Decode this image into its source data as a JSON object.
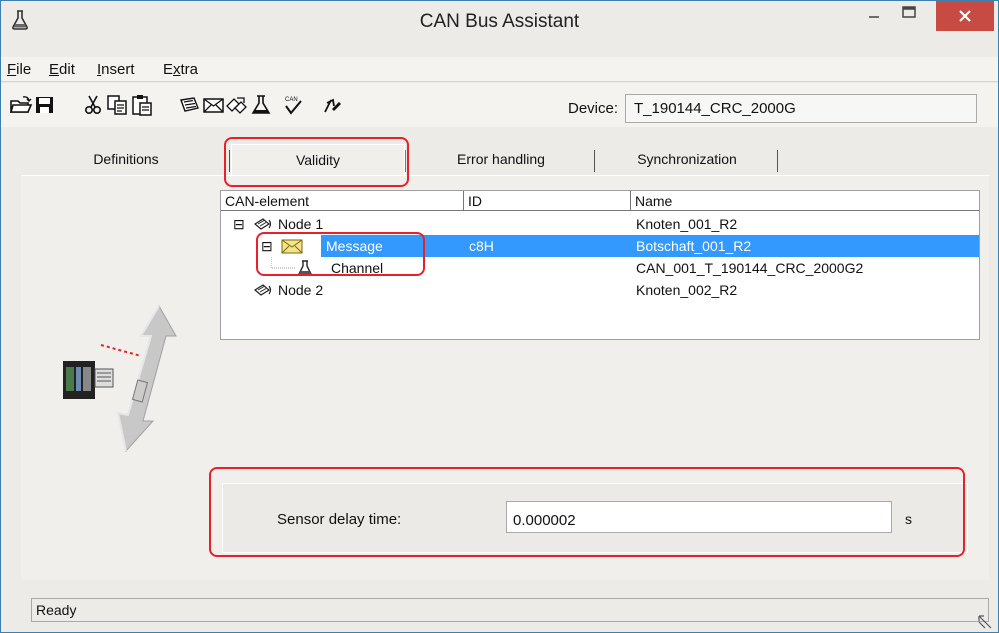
{
  "window": {
    "title": "CAN Bus Assistant",
    "accent_close": "#c74b43"
  },
  "menu": [
    {
      "label": "File",
      "hotkey": "F",
      "rest": "ile"
    },
    {
      "label": "Edit",
      "hotkey": "E",
      "rest": "dit"
    },
    {
      "label": "Insert",
      "hotkey": "I",
      "rest": "nsert"
    },
    {
      "label": "Extra",
      "hotkey": "x",
      "pre": "E",
      "rest": "tra"
    }
  ],
  "toolbar": {
    "icons": [
      "open-folder-icon",
      "save-icon",
      "cut-icon",
      "copy-icon",
      "paste-icon",
      "can-node-icon",
      "message-envelope-icon",
      "multi-node-icon",
      "channel-flask-icon",
      "can-check-icon",
      "import-icon"
    ],
    "device_label": "Device:",
    "device_value": "T_190144_CRC_2000G"
  },
  "tabs": [
    {
      "label": "Definitions"
    },
    {
      "label": "Validity",
      "active": true
    },
    {
      "label": "Error handling"
    },
    {
      "label": "Synchronization"
    }
  ],
  "tree": {
    "headers": {
      "element": "CAN-element",
      "id": "ID",
      "name": "Name"
    },
    "rows": [
      {
        "element": "Node 1",
        "id": "",
        "name": "Knoten_001_R2",
        "expander": "⊟",
        "icon": "node-icon"
      },
      {
        "element": "Message",
        "id": "c8H",
        "name": "Botschaft_001_R2",
        "expander": "⊟",
        "icon": "message-envelope-icon",
        "selected": true
      },
      {
        "element": "Channel",
        "id": "",
        "name": "CAN_001_T_190144_CRC_2000G2",
        "icon": "channel-flask-icon"
      },
      {
        "element": "Node 2",
        "id": "",
        "name": "Knoten_002_R2",
        "icon": "node-icon"
      }
    ]
  },
  "sensor": {
    "label": "Sensor delay time:",
    "value": "0.000002",
    "unit": "s"
  },
  "status": {
    "text": "Ready"
  },
  "colors": {
    "selection": "#3399ff",
    "highlight": "#e8202a"
  }
}
